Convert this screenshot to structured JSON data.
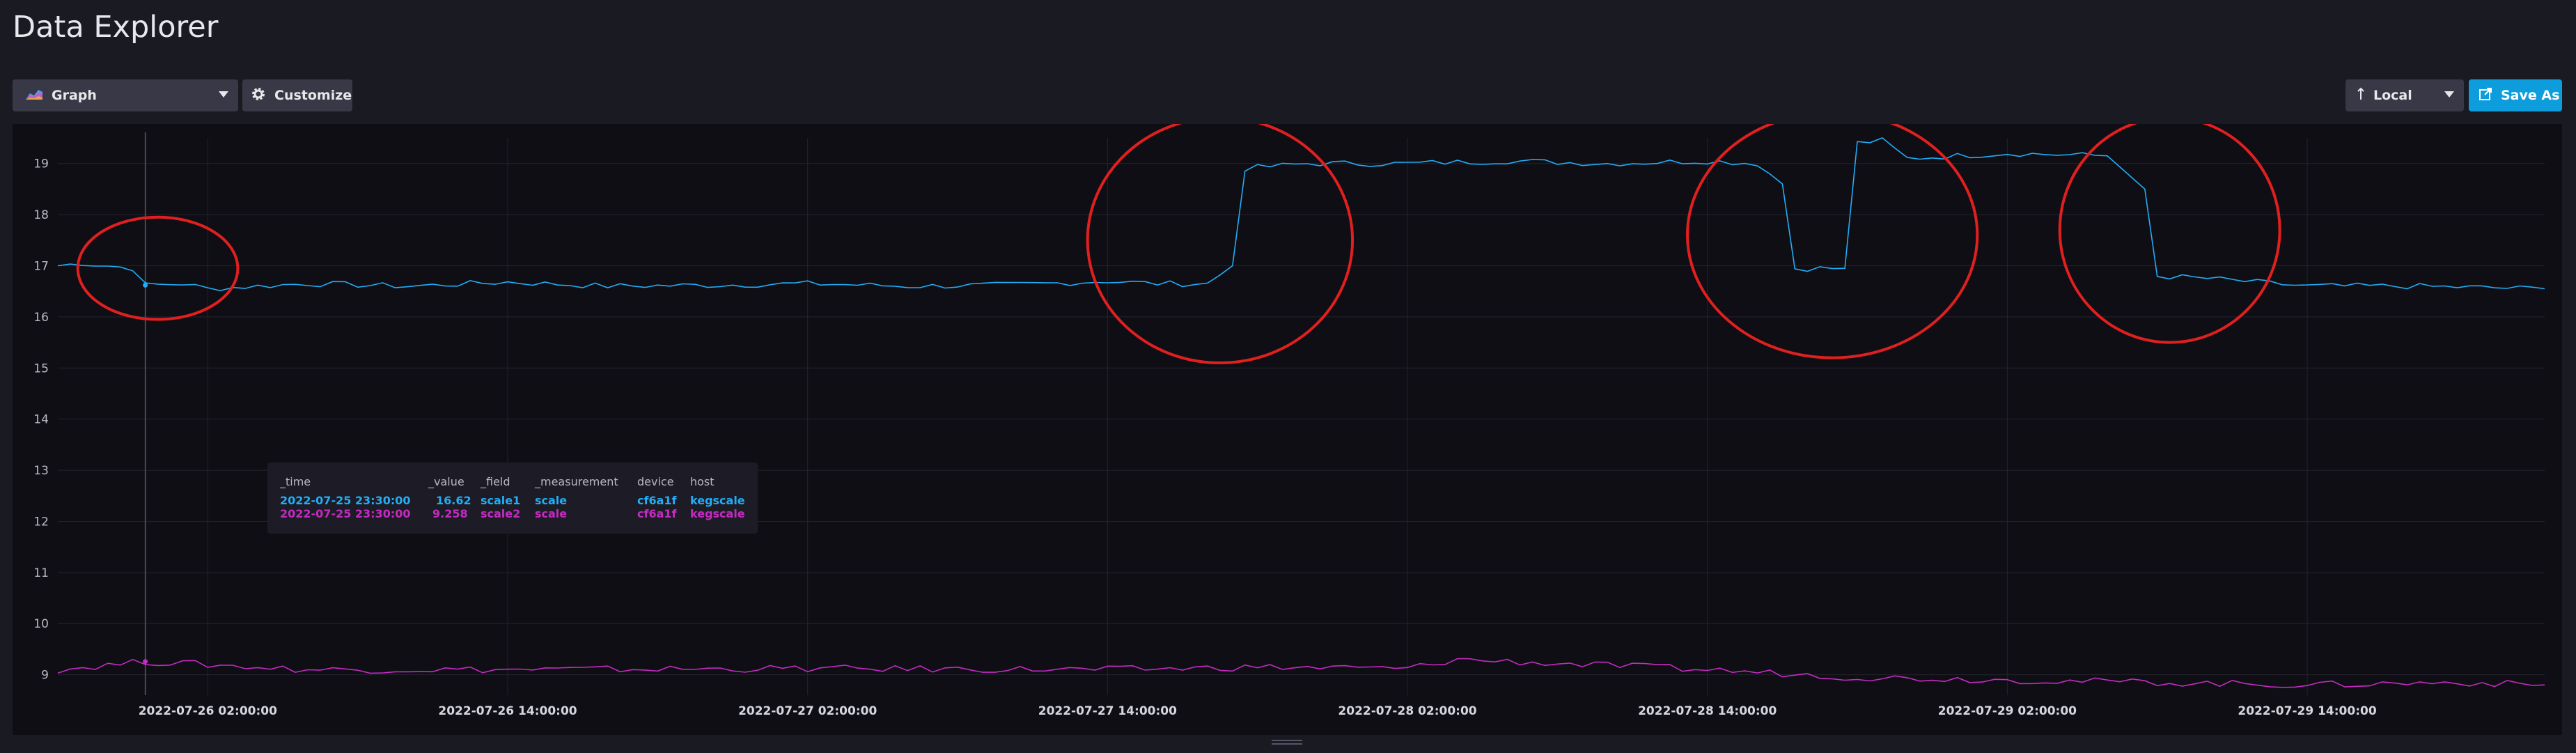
{
  "page": {
    "title": "Data Explorer"
  },
  "toolbar": {
    "graph_label": "Graph",
    "customize_label": "Customize",
    "timezone_label": "Local",
    "save_label": "Save As",
    "graph_icon": "graph-icon",
    "customize_icon": "gear-icon",
    "timezone_icon": "arrow-up-icon",
    "save_icon": "export-icon"
  },
  "colors": {
    "series1": "#22adf6",
    "series2": "#c42bc1",
    "accent": "#0e9ddc",
    "annotation": "#e0201f"
  },
  "tooltip": {
    "headers": [
      "_time",
      "_value",
      "_field",
      "_measurement",
      "device",
      "host"
    ],
    "rows": [
      [
        "2022-07-25 23:30:00",
        "16.62",
        "scale1",
        "scale",
        "cf6a1f",
        "kegscale"
      ],
      [
        "2022-07-25 23:30:00",
        "9.258",
        "scale2",
        "scale",
        "cf6a1f",
        "kegscale"
      ]
    ]
  },
  "chart_data": {
    "type": "line",
    "x_start": "2022-07-25 20:00:00",
    "x_end": "2022-07-29 23:30:00",
    "ylim": [
      8.6,
      19.5
    ],
    "y_ticks": [
      9,
      10,
      11,
      12,
      13,
      14,
      15,
      16,
      17,
      18,
      19
    ],
    "x_ticks": [
      "2022-07-26 02:00:00",
      "2022-07-26 14:00:00",
      "2022-07-27 02:00:00",
      "2022-07-27 14:00:00",
      "2022-07-28 02:00:00",
      "2022-07-28 14:00:00",
      "2022-07-29 02:00:00",
      "2022-07-29 14:00:00"
    ],
    "grid": true,
    "hover_time": "2022-07-25 23:30:00",
    "series": [
      {
        "points": [
          [
            "2022-07-25 20:00:00",
            17.0
          ],
          [
            "2022-07-25 21:00:00",
            17.05
          ],
          [
            "2022-07-25 22:00:00",
            17.0
          ],
          [
            "2022-07-25 23:00:00",
            16.95
          ],
          [
            "2022-07-25 23:30:00",
            16.62
          ],
          [
            "2022-07-26 01:00:00",
            16.65
          ],
          [
            "2022-07-26 02:00:00",
            16.55
          ],
          [
            "2022-07-26 06:00:00",
            16.65
          ],
          [
            "2022-07-26 10:00:00",
            16.6
          ],
          [
            "2022-07-26 14:00:00",
            16.68
          ],
          [
            "2022-07-26 18:00:00",
            16.6
          ],
          [
            "2022-07-26 22:00:00",
            16.62
          ],
          [
            "2022-07-27 02:00:00",
            16.65
          ],
          [
            "2022-07-27 06:00:00",
            16.6
          ],
          [
            "2022-07-27 10:00:00",
            16.62
          ],
          [
            "2022-07-27 14:00:00",
            16.7
          ],
          [
            "2022-07-27 16:00:00",
            16.65
          ],
          [
            "2022-07-27 18:00:00",
            16.65
          ],
          [
            "2022-07-27 19:00:00",
            17.0
          ],
          [
            "2022-07-27 19:30:00",
            18.9
          ],
          [
            "2022-07-27 22:00:00",
            19.0
          ],
          [
            "2022-07-28 02:00:00",
            19.0
          ],
          [
            "2022-07-28 06:00:00",
            19.05
          ],
          [
            "2022-07-28 10:00:00",
            19.0
          ],
          [
            "2022-07-28 14:00:00",
            19.05
          ],
          [
            "2022-07-28 16:00:00",
            19.0
          ],
          [
            "2022-07-28 17:00:00",
            18.6
          ],
          [
            "2022-07-28 17:30:00",
            16.95
          ],
          [
            "2022-07-28 19:30:00",
            16.95
          ],
          [
            "2022-07-28 20:00:00",
            19.4
          ],
          [
            "2022-07-28 21:00:00",
            19.45
          ],
          [
            "2022-07-28 22:00:00",
            19.1
          ],
          [
            "2022-07-29 02:00:00",
            19.2
          ],
          [
            "2022-07-29 06:00:00",
            19.15
          ],
          [
            "2022-07-29 07:30:00",
            18.5
          ],
          [
            "2022-07-29 08:00:00",
            16.8
          ],
          [
            "2022-07-29 10:00:00",
            16.75
          ],
          [
            "2022-07-29 14:00:00",
            16.6
          ],
          [
            "2022-07-29 18:00:00",
            16.6
          ],
          [
            "2022-07-29 23:30:00",
            16.55
          ]
        ]
      },
      {
        "points": [
          [
            "2022-07-25 20:00:00",
            9.1
          ],
          [
            "2022-07-25 23:30:00",
            9.258
          ],
          [
            "2022-07-26 06:00:00",
            9.1
          ],
          [
            "2022-07-26 14:00:00",
            9.1
          ],
          [
            "2022-07-27 02:00:00",
            9.12
          ],
          [
            "2022-07-27 14:00:00",
            9.1
          ],
          [
            "2022-07-27 20:00:00",
            9.15
          ],
          [
            "2022-07-28 02:00:00",
            9.12
          ],
          [
            "2022-07-28 04:00:00",
            9.3
          ],
          [
            "2022-07-28 14:00:00",
            9.1
          ],
          [
            "2022-07-28 20:00:00",
            8.95
          ],
          [
            "2022-07-29 02:00:00",
            8.9
          ],
          [
            "2022-07-29 14:00:00",
            8.8
          ],
          [
            "2022-07-29 20:00:00",
            8.85
          ],
          [
            "2022-07-29 23:30:00",
            8.8
          ]
        ]
      }
    ],
    "annotations": [
      {
        "label": "circle-1",
        "x_center": "2022-07-26 00:00:00",
        "y_center": 16.95,
        "x_hours_radius": 3.2,
        "y_radius": 1.0
      },
      {
        "label": "circle-2",
        "x_center": "2022-07-27 18:30:00",
        "y_center": 17.5,
        "x_hours_radius": 5.3,
        "y_radius": 2.4
      },
      {
        "label": "circle-3",
        "x_center": "2022-07-28 19:00:00",
        "y_center": 17.6,
        "x_hours_radius": 5.8,
        "y_radius": 2.4
      },
      {
        "label": "circle-4",
        "x_center": "2022-07-29 08:30:00",
        "y_center": 17.7,
        "x_hours_radius": 4.4,
        "y_radius": 2.2
      }
    ]
  }
}
